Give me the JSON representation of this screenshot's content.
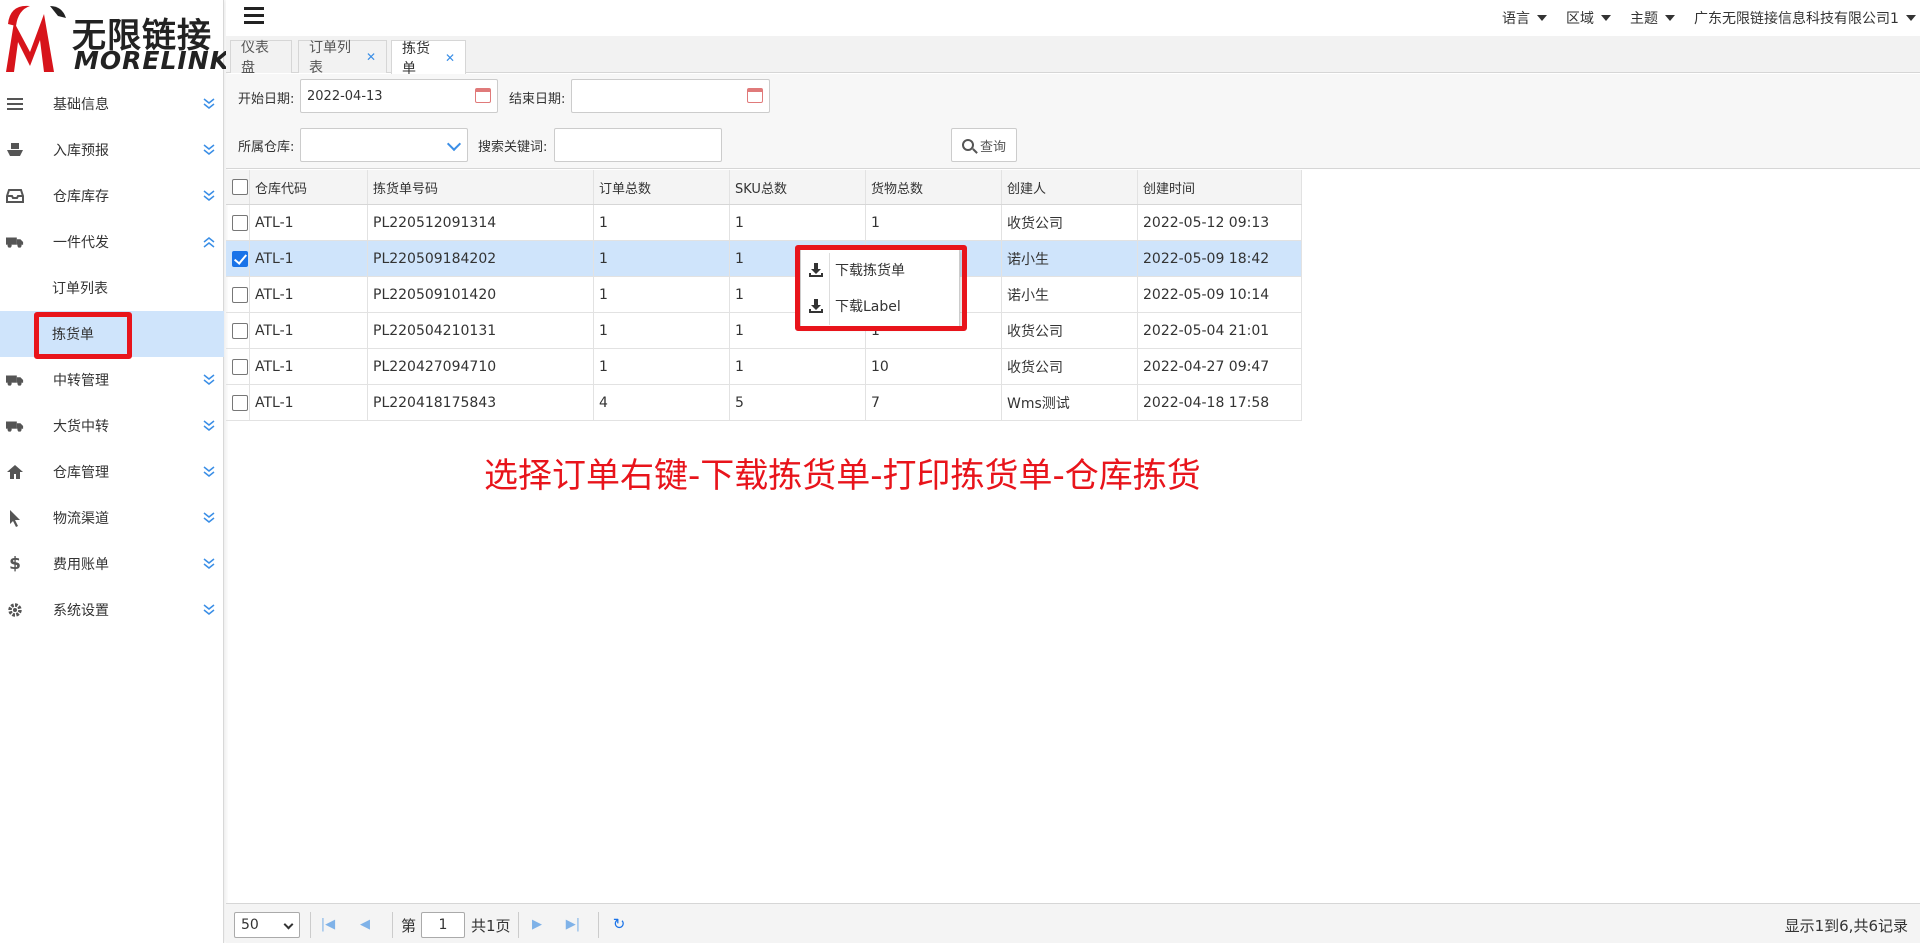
{
  "logo": {
    "cn": "无限链接",
    "en": "MORELINK"
  },
  "sidebar": {
    "items": [
      {
        "label": "基础信息",
        "icon": "list-icon"
      },
      {
        "label": "入库预报",
        "icon": "ship-icon"
      },
      {
        "label": "仓库库存",
        "icon": "inbox-icon"
      },
      {
        "label": "一件代发",
        "icon": "truck-icon",
        "expanded": true
      },
      {
        "label": "中转管理",
        "icon": "truck-icon"
      },
      {
        "label": "大货中转",
        "icon": "truck-icon"
      },
      {
        "label": "仓库管理",
        "icon": "home-icon"
      },
      {
        "label": "物流渠道",
        "icon": "pointer-icon"
      },
      {
        "label": "费用账单",
        "icon": "dollar-icon"
      },
      {
        "label": "系统设置",
        "icon": "gear-icon"
      }
    ],
    "subitems": [
      {
        "label": "订单列表"
      },
      {
        "label": "拣货单",
        "active": true
      }
    ]
  },
  "topbar": {
    "language": "语言",
    "region": "区域",
    "theme": "主题",
    "company": "广东无限链接信息科技有限公司1"
  },
  "tabs": [
    {
      "label": "仪表盘",
      "closable": false
    },
    {
      "label": "订单列表",
      "closable": true
    },
    {
      "label": "拣货单",
      "closable": true,
      "active": true
    }
  ],
  "filter": {
    "start_label": "开始日期:",
    "start_value": "2022-04-13",
    "end_label": "结束日期:",
    "end_value": "",
    "warehouse_label": "所属仓库:",
    "warehouse_value": "",
    "keyword_label": "搜索关键词:",
    "keyword_value": "",
    "search_label": "查询"
  },
  "table": {
    "columns": [
      "仓库代码",
      "拣货单号码",
      "订单总数",
      "SKU总数",
      "货物总数",
      "创建人",
      "创建时间"
    ],
    "rows": [
      {
        "checked": false,
        "cells": [
          "ATL-1",
          "PL220512091314",
          "1",
          "1",
          "1",
          "收货公司",
          "2022-05-12 09:13"
        ]
      },
      {
        "checked": true,
        "cells": [
          "ATL-1",
          "PL220509184202",
          "1",
          "1",
          "",
          "诺小生",
          "2022-05-09 18:42"
        ]
      },
      {
        "checked": false,
        "cells": [
          "ATL-1",
          "PL220509101420",
          "1",
          "1",
          "",
          "诺小生",
          "2022-05-09 10:14"
        ]
      },
      {
        "checked": false,
        "cells": [
          "ATL-1",
          "PL220504210131",
          "1",
          "1",
          "1",
          "收货公司",
          "2022-05-04 21:01"
        ]
      },
      {
        "checked": false,
        "cells": [
          "ATL-1",
          "PL220427094710",
          "1",
          "1",
          "10",
          "收货公司",
          "2022-04-27 09:47"
        ]
      },
      {
        "checked": false,
        "cells": [
          "ATL-1",
          "PL220418175843",
          "4",
          "5",
          "7",
          "Wms测试",
          "2022-04-18 17:58"
        ]
      }
    ]
  },
  "context_menu": {
    "items": [
      {
        "label": "下载拣货单",
        "icon": "download-icon"
      },
      {
        "label": "下载Label",
        "icon": "download-icon"
      }
    ]
  },
  "annotation": "选择订单右键-下载拣货单-打印拣货单-仓库拣货",
  "pager": {
    "page_size": "50",
    "page_prefix": "第",
    "page_value": "1",
    "page_suffix": "共1页",
    "info": "显示1到6,共6记录"
  },
  "colors": {
    "accent": "#1a73e8",
    "selected_row": "#cfe4fb",
    "annotation": "#e8141b"
  }
}
